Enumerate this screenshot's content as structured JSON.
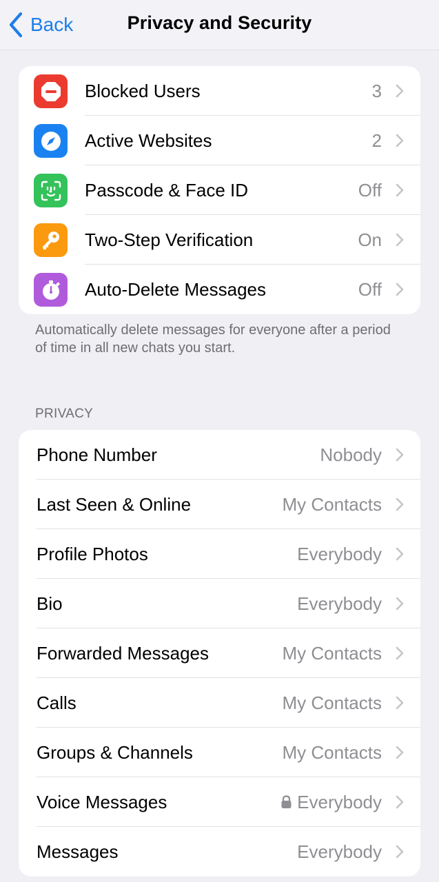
{
  "navbar": {
    "back_label": "Back",
    "title": "Privacy and Security"
  },
  "security_group": {
    "items": [
      {
        "label": "Blocked Users",
        "value": "3",
        "icon": "blocked-icon",
        "color": "#eb3b30"
      },
      {
        "label": "Active Websites",
        "value": "2",
        "icon": "compass-icon",
        "color": "#1a82f0"
      },
      {
        "label": "Passcode & Face ID",
        "value": "Off",
        "icon": "face-id-icon",
        "color": "#34c25a"
      },
      {
        "label": "Two-Step Verification",
        "value": "On",
        "icon": "key-icon",
        "color": "#fb9a0f"
      },
      {
        "label": "Auto-Delete Messages",
        "value": "Off",
        "icon": "timer-icon",
        "color": "#b05bdc"
      }
    ],
    "footer": "Automatically delete messages for everyone after a period of time in all new chats you start."
  },
  "privacy_group": {
    "header": "PRIVACY",
    "items": [
      {
        "label": "Phone Number",
        "value": "Nobody"
      },
      {
        "label": "Last Seen & Online",
        "value": "My Contacts"
      },
      {
        "label": "Profile Photos",
        "value": "Everybody"
      },
      {
        "label": "Bio",
        "value": "Everybody"
      },
      {
        "label": "Forwarded Messages",
        "value": "My Contacts"
      },
      {
        "label": "Calls",
        "value": "My Contacts"
      },
      {
        "label": "Groups & Channels",
        "value": "My Contacts"
      },
      {
        "label": "Voice Messages",
        "value": "Everybody",
        "locked": true
      },
      {
        "label": "Messages",
        "value": "Everybody"
      }
    ]
  }
}
